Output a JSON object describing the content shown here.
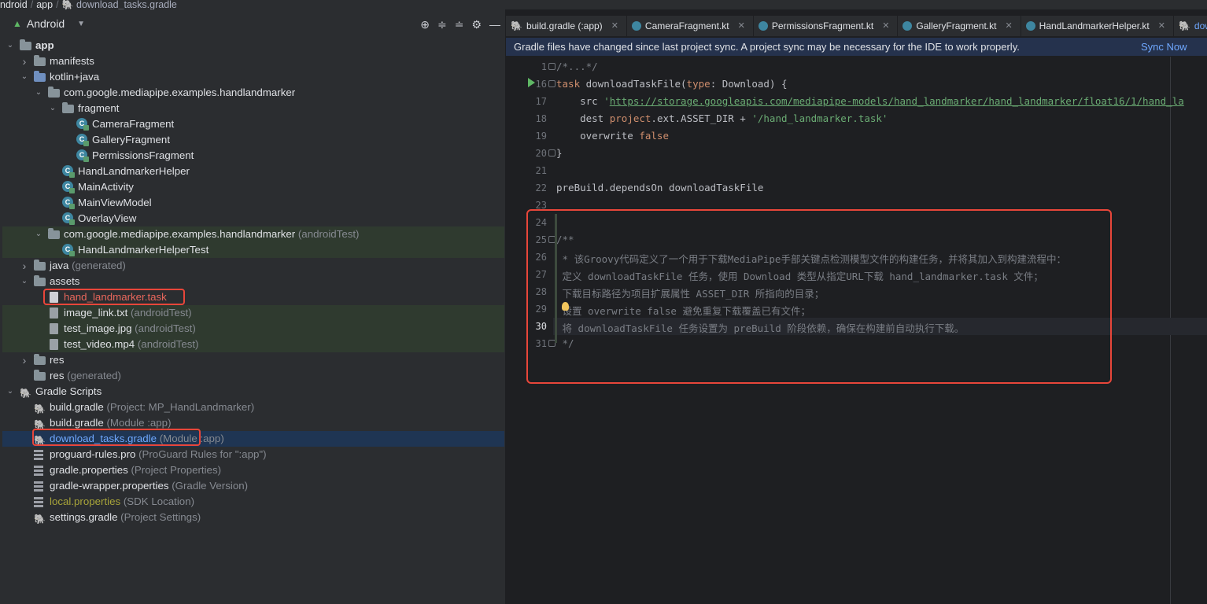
{
  "breadcrumb": {
    "items": [
      "ndroid",
      "app",
      "download_tasks.gradle"
    ]
  },
  "project_panel": {
    "view_label": "Android",
    "tree": [
      {
        "label": "app",
        "hint": "",
        "indent": 0,
        "icon": "module-folder-icon",
        "arrow": "down"
      },
      {
        "label": "manifests",
        "hint": "",
        "indent": 1,
        "icon": "folder-icon",
        "arrow": "right"
      },
      {
        "label": "kotlin+java",
        "hint": "",
        "indent": 1,
        "icon": "source-folder-icon",
        "arrow": "down"
      },
      {
        "label": "com.google.mediapipe.examples.handlandmarker",
        "hint": "",
        "indent": 2,
        "icon": "package-icon",
        "arrow": "down"
      },
      {
        "label": "fragment",
        "hint": "",
        "indent": 3,
        "icon": "package-icon",
        "arrow": "down"
      },
      {
        "label": "CameraFragment",
        "hint": "",
        "indent": 4,
        "icon": "kotlin-class-icon",
        "arrow": ""
      },
      {
        "label": "GalleryFragment",
        "hint": "",
        "indent": 4,
        "icon": "kotlin-class-icon",
        "arrow": ""
      },
      {
        "label": "PermissionsFragment",
        "hint": "",
        "indent": 4,
        "icon": "kotlin-class-icon",
        "arrow": ""
      },
      {
        "label": "HandLandmarkerHelper",
        "hint": "",
        "indent": 3,
        "icon": "kotlin-class-icon",
        "arrow": ""
      },
      {
        "label": "MainActivity",
        "hint": "",
        "indent": 3,
        "icon": "kotlin-class-icon",
        "arrow": ""
      },
      {
        "label": "MainViewModel",
        "hint": "",
        "indent": 3,
        "icon": "kotlin-class-icon",
        "arrow": ""
      },
      {
        "label": "OverlayView",
        "hint": "",
        "indent": 3,
        "icon": "kotlin-class-icon",
        "arrow": ""
      },
      {
        "label": "com.google.mediapipe.examples.handlandmarker",
        "hint": "(androidTest)",
        "indent": 2,
        "icon": "package-icon",
        "arrow": "down",
        "test": true
      },
      {
        "label": "HandLandmarkerHelperTest",
        "hint": "",
        "indent": 3,
        "icon": "kotlin-class-icon",
        "arrow": "",
        "test": true
      },
      {
        "label": "java",
        "hint": "(generated)",
        "indent": 1,
        "icon": "folder-icon",
        "arrow": "right"
      },
      {
        "label": "assets",
        "hint": "",
        "indent": 1,
        "icon": "folder-icon",
        "arrow": "down"
      },
      {
        "label": "hand_landmarker.task",
        "hint": "",
        "indent": 2,
        "icon": "file-icon",
        "arrow": "",
        "red": true
      },
      {
        "label": "image_link.txt",
        "hint": "(androidTest)",
        "indent": 2,
        "icon": "text-file-icon",
        "arrow": "",
        "test": true
      },
      {
        "label": "test_image.jpg",
        "hint": "(androidTest)",
        "indent": 2,
        "icon": "image-file-icon",
        "arrow": "",
        "test": true
      },
      {
        "label": "test_video.mp4",
        "hint": "(androidTest)",
        "indent": 2,
        "icon": "video-file-icon",
        "arrow": "",
        "test": true
      },
      {
        "label": "res",
        "hint": "",
        "indent": 1,
        "icon": "folder-icon",
        "arrow": "right"
      },
      {
        "label": "res",
        "hint": "(generated)",
        "indent": 1,
        "icon": "folder-icon",
        "arrow": ""
      },
      {
        "label": "Gradle Scripts",
        "hint": "",
        "indent": 0,
        "icon": "gradle-icon",
        "arrow": "down"
      },
      {
        "label": "build.gradle",
        "hint": "(Project: MP_HandLandmarker)",
        "indent": 1,
        "icon": "gradle-icon",
        "arrow": ""
      },
      {
        "label": "build.gradle",
        "hint": "(Module :app)",
        "indent": 1,
        "icon": "gradle-icon",
        "arrow": ""
      },
      {
        "label": "download_tasks.gradle",
        "hint": "(Module :app)",
        "indent": 1,
        "icon": "gradle-icon",
        "arrow": "",
        "selected": true
      },
      {
        "label": "proguard-rules.pro",
        "hint": "(ProGuard Rules for \":app\")",
        "indent": 1,
        "icon": "properties-file-icon",
        "arrow": ""
      },
      {
        "label": "gradle.properties",
        "hint": "(Project Properties)",
        "indent": 1,
        "icon": "properties-file-icon",
        "arrow": ""
      },
      {
        "label": "gradle-wrapper.properties",
        "hint": "(Gradle Version)",
        "indent": 1,
        "icon": "properties-file-icon",
        "arrow": ""
      },
      {
        "label": "local.properties",
        "hint": "(SDK Location)",
        "indent": 1,
        "icon": "properties-file-icon",
        "arrow": "",
        "ignored": true
      },
      {
        "label": "settings.gradle",
        "hint": "(Project Settings)",
        "indent": 1,
        "icon": "gradle-icon",
        "arrow": ""
      }
    ]
  },
  "tabs": [
    {
      "label": "build.gradle (:app)",
      "icon": "gradle-icon"
    },
    {
      "label": "CameraFragment.kt",
      "icon": "kotlin-class-icon"
    },
    {
      "label": "PermissionsFragment.kt",
      "icon": "kotlin-class-icon"
    },
    {
      "label": "GalleryFragment.kt",
      "icon": "kotlin-class-icon"
    },
    {
      "label": "HandLandmarkerHelper.kt",
      "icon": "kotlin-class-icon"
    },
    {
      "label": "download_",
      "icon": "gradle-icon",
      "active": true
    }
  ],
  "banner": {
    "message": "Gradle files have changed since last project sync. A project sync may be necessary for the IDE to work properly.",
    "action": "Sync Now"
  },
  "code": [
    {
      "num": "1",
      "segments": [
        {
          "t": "/*...*/",
          "c": "cmt"
        }
      ]
    },
    {
      "num": "16",
      "segments": [
        {
          "t": "task",
          "c": "kw"
        },
        {
          "t": " downloadTaskFile(",
          "c": ""
        },
        {
          "t": "type",
          "c": "kw"
        },
        {
          "t": ": Download) {",
          "c": ""
        }
      ]
    },
    {
      "num": "17",
      "segments": [
        {
          "t": "    src ",
          "c": ""
        },
        {
          "t": "'",
          "c": "str"
        },
        {
          "t": "https://storage.googleapis.com/mediapipe-models/hand_landmarker/hand_landmarker/float16/1/hand_la",
          "c": "url"
        }
      ]
    },
    {
      "num": "18",
      "segments": [
        {
          "t": "    dest ",
          "c": ""
        },
        {
          "t": "project",
          "c": "kw"
        },
        {
          "t": ".ext.ASSET_DIR + ",
          "c": ""
        },
        {
          "t": "'/hand_landmarker.task'",
          "c": "str"
        }
      ]
    },
    {
      "num": "19",
      "segments": [
        {
          "t": "    overwrite ",
          "c": ""
        },
        {
          "t": "false",
          "c": "kw"
        }
      ]
    },
    {
      "num": "20",
      "segments": [
        {
          "t": "}",
          "c": ""
        }
      ]
    },
    {
      "num": "21",
      "segments": []
    },
    {
      "num": "22",
      "segments": [
        {
          "t": "preBuild.dependsOn downloadTaskFile",
          "c": ""
        }
      ]
    },
    {
      "num": "23",
      "segments": []
    },
    {
      "num": "24",
      "segments": []
    },
    {
      "num": "25",
      "segments": [
        {
          "t": "/**",
          "c": "cmt"
        }
      ]
    },
    {
      "num": "26",
      "segments": [
        {
          "t": " * 该Groovy代码定义了一个用于下载MediaPipe手部关键点检测模型文件的构建任务，并将其加入到构建流程中：",
          "c": "cmt"
        }
      ]
    },
    {
      "num": "27",
      "segments": [
        {
          "t": " 定义 downloadTaskFile 任务，使用 Download 类型从指定URL下载 hand_landmarker.task 文件；",
          "c": "cmt"
        }
      ]
    },
    {
      "num": "28",
      "segments": [
        {
          "t": " 下载目标路径为项目扩展属性 ASSET_DIR 所指向的目录；",
          "c": "cmt"
        }
      ]
    },
    {
      "num": "29",
      "segments": [
        {
          "t": " 设置 overwrite false 避免重复下载覆盖已有文件；",
          "c": "cmt"
        }
      ]
    },
    {
      "num": "30",
      "segments": [
        {
          "t": " 将 downloadTaskFile 任务设置为 preBuild 阶段依赖，确保在构建前自动执行下载。",
          "c": "cmt"
        }
      ]
    },
    {
      "num": "31",
      "segments": [
        {
          "t": " */",
          "c": "cmt"
        }
      ]
    }
  ],
  "colors": {
    "accent": "#3574f0",
    "highlight_border": "#e8463a",
    "keyword": "#cf8e6d",
    "string": "#6aab73",
    "comment": "#7a7e85"
  }
}
